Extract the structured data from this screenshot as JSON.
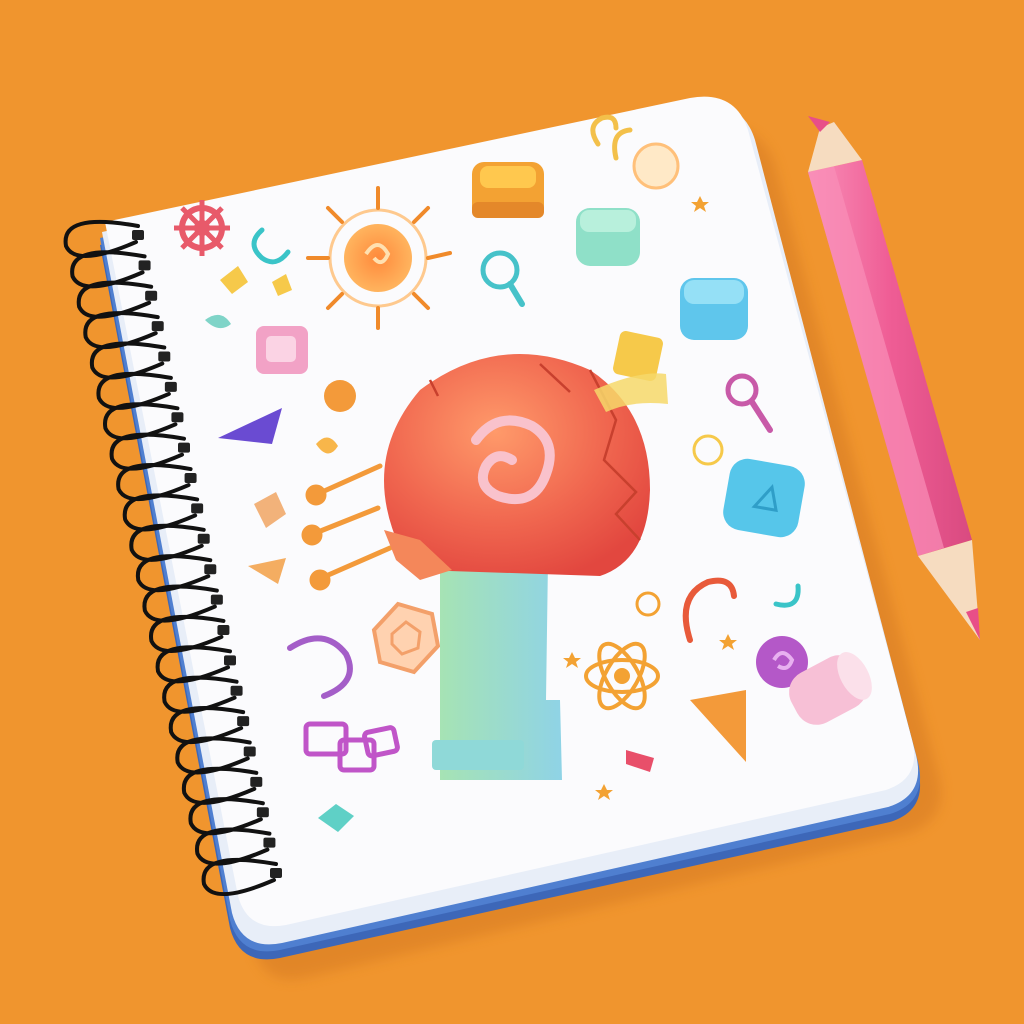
{
  "scene": {
    "background_color": "#f0952e",
    "notebook": {
      "page_color": "#fbfbfd",
      "edge_color": "#4f7fd0",
      "spiral_color": "#111111",
      "binding_holes": 22
    },
    "pencil": {
      "body_color": "#ef5d95",
      "highlight_color": "#f98fb8",
      "wood_color": "#f6dcc0",
      "tip_color": "#e84f88"
    },
    "central_figure": {
      "head_color": "#f0664f",
      "stem_color": "#9edfc8",
      "base_color": "#8fd9d8"
    },
    "doodle_icons": [
      "gear-icon",
      "sun-icon",
      "drum-icon",
      "magnifier-icon",
      "lightbulb-icon",
      "hook-icon",
      "atom-icon",
      "spiral-icon",
      "hexagon-icon",
      "triangle-icon",
      "star-icon",
      "cube-icon",
      "arrow-icon",
      "gem-icon",
      "cylinder-icon"
    ]
  }
}
